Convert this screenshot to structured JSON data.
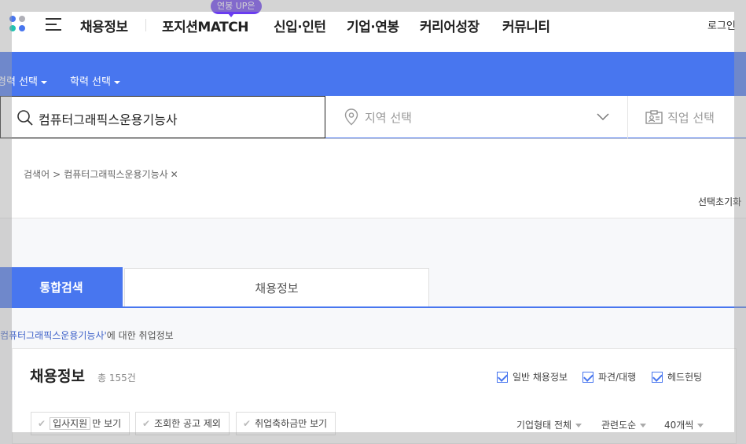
{
  "nav": {
    "items": [
      "채용정보",
      "포지션MATCH",
      "신입·인턴",
      "기업·연봉",
      "커리어성장",
      "커뮤니티"
    ],
    "match_badge": "연봉 UP은",
    "login": "로그인"
  },
  "filters": {
    "career": "경력 선택",
    "education": "학력 선택"
  },
  "search": {
    "keyword": "컴퓨터그래픽스운용기능사",
    "region_placeholder": "지역 선택",
    "job_placeholder": "직업 선택"
  },
  "breadcrumb": {
    "label": "검색어",
    "separator": ">",
    "term": "컴퓨터그래픽스운용기능사"
  },
  "reset_label": "선택초기화",
  "tabs": {
    "active": "통합검색",
    "second": "채용정보"
  },
  "about": {
    "query": "컴퓨터그래픽스운용기능사'",
    "suffix": "에 대한 취업정보"
  },
  "section": {
    "title": "채용정보",
    "count": "총 155건",
    "checkboxes": [
      "일반 채용정보",
      "파견/대행",
      "헤드헌팅"
    ],
    "pills": {
      "p1_highlight": "입사지원",
      "p1_suffix": "만 보기",
      "p2": "조회한 공고 제외",
      "p3": "취업축하금만 보기"
    },
    "sorters": [
      "기업형태 전체",
      "관련도순",
      "40개씩"
    ]
  },
  "colors": {
    "primary": "#4876ef",
    "badge": "#6a3cf0"
  }
}
